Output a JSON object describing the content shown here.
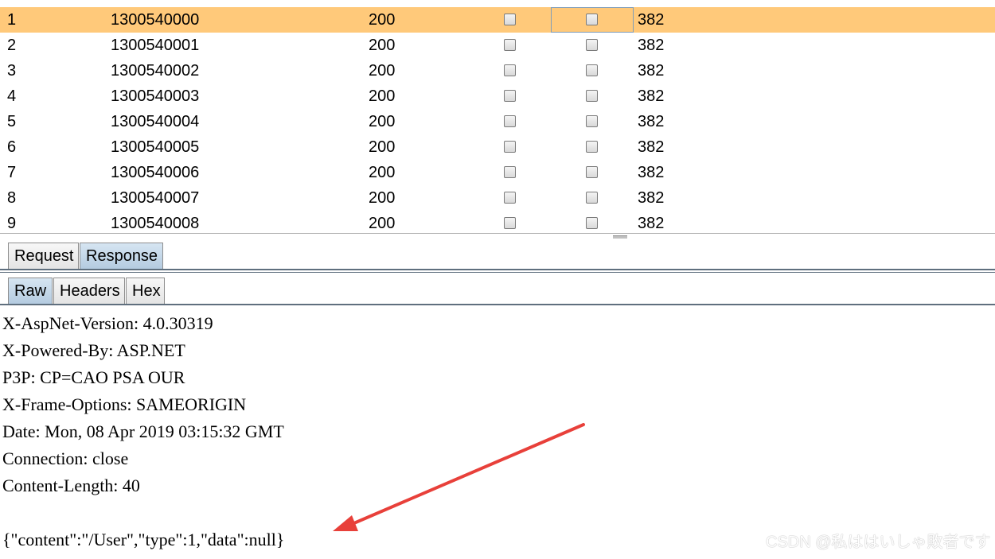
{
  "results": {
    "partial_top_row": {
      "num": "",
      "payload": "",
      "status": "",
      "length": ""
    },
    "rows": [
      {
        "num": "1",
        "payload": "1300540000",
        "status": "200",
        "length": "382",
        "selected": true
      },
      {
        "num": "2",
        "payload": "1300540001",
        "status": "200",
        "length": "382"
      },
      {
        "num": "3",
        "payload": "1300540002",
        "status": "200",
        "length": "382"
      },
      {
        "num": "4",
        "payload": "1300540003",
        "status": "200",
        "length": "382"
      },
      {
        "num": "5",
        "payload": "1300540004",
        "status": "200",
        "length": "382"
      },
      {
        "num": "6",
        "payload": "1300540005",
        "status": "200",
        "length": "382"
      },
      {
        "num": "7",
        "payload": "1300540006",
        "status": "200",
        "length": "382"
      },
      {
        "num": "8",
        "payload": "1300540007",
        "status": "200",
        "length": "382"
      },
      {
        "num": "9",
        "payload": "1300540008",
        "status": "200",
        "length": "382"
      }
    ],
    "selected_row_color": "#ffc97a"
  },
  "main_tabs": [
    {
      "label": "Request",
      "active": false
    },
    {
      "label": "Response",
      "active": true
    }
  ],
  "view_tabs": [
    {
      "label": "Raw",
      "active": true
    },
    {
      "label": "Headers",
      "active": false
    },
    {
      "label": "Hex",
      "active": false
    }
  ],
  "response": {
    "headers": [
      "X-AspNet-Version: 4.0.30319",
      "X-Powered-By: ASP.NET",
      "P3P: CP=CAO PSA OUR",
      "X-Frame-Options: SAMEORIGIN",
      "Date: Mon, 08 Apr 2019 03:15:32 GMT",
      "Connection: close",
      "Content-Length: 40"
    ],
    "body": "{\"content\":\"/User\",\"type\":1,\"data\":null}"
  },
  "annotation": {
    "arrow_color": "#e8403a"
  },
  "watermark": "CSDN @私ははいしゃ敗者です"
}
